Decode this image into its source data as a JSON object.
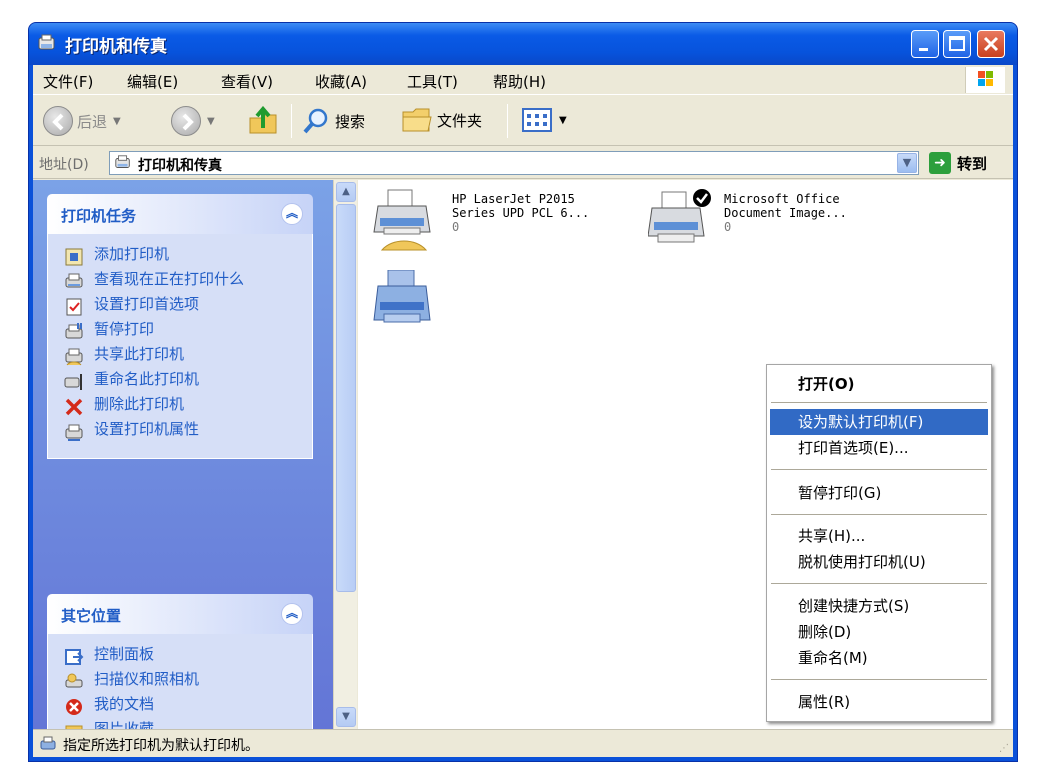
{
  "window": {
    "title": "打印机和传真",
    "controls": {
      "minimize": "minimize-icon",
      "maximize": "maximize-icon",
      "close": "close-icon"
    }
  },
  "menubar": {
    "items": [
      "文件(F)",
      "编辑(E)",
      "查看(V)",
      "收藏(A)",
      "工具(T)",
      "帮助(H)"
    ]
  },
  "toolbar": {
    "back_label": "后退",
    "search_label": "搜索",
    "folders_label": "文件夹"
  },
  "address": {
    "label": "地址(D)",
    "value": "打印机和传真",
    "go_label": "转到"
  },
  "tasks_panel": {
    "title": "打印机任务",
    "items": [
      {
        "label": "添加打印机",
        "icon": "add-printer-icon"
      },
      {
        "label": "查看现在正在打印什么",
        "icon": "view-queue-icon"
      },
      {
        "label": "设置打印首选项",
        "icon": "preferences-icon"
      },
      {
        "label": "暂停打印",
        "icon": "pause-printing-icon"
      },
      {
        "label": "共享此打印机",
        "icon": "share-printer-icon"
      },
      {
        "label": "重命名此打印机",
        "icon": "rename-printer-icon"
      },
      {
        "label": "删除此打印机",
        "icon": "delete-icon"
      },
      {
        "label": "设置打印机属性",
        "icon": "printer-properties-icon"
      }
    ]
  },
  "places_panel": {
    "title": "其它位置",
    "items": [
      {
        "label": "控制面板",
        "icon": "control-panel-icon"
      },
      {
        "label": "扫描仪和照相机",
        "icon": "scanner-camera-icon"
      },
      {
        "label": "我的文档",
        "icon": "my-documents-icon"
      },
      {
        "label": "图片收藏",
        "icon": "my-pictures-icon"
      }
    ]
  },
  "printers": [
    {
      "name_line1": "HP LaserJet P2015",
      "name_line2": "Series UPD PCL 6...",
      "count": "0",
      "shared": true,
      "default": false
    },
    {
      "name_line1": "Microsoft Office",
      "name_line2": "Document Image...",
      "count": "0",
      "shared": false,
      "default": true
    }
  ],
  "context_menu": {
    "items": {
      "open": "打开(O)",
      "set_default": "设为默认打印机(F)",
      "preferences": "打印首选项(E)...",
      "pause": "暂停打印(G)",
      "sharing": "共享(H)...",
      "offline": "脱机使用打印机(U)",
      "shortcut": "创建快捷方式(S)",
      "delete": "删除(D)",
      "rename": "重命名(M)",
      "properties": "属性(R)"
    },
    "highlighted": "set_default"
  },
  "statusbar": {
    "text": "指定所选打印机为默认打印机。"
  },
  "colors": {
    "title_blue": "#0a5ae6",
    "link_blue": "#215dc6",
    "highlight": "#316ac5"
  }
}
